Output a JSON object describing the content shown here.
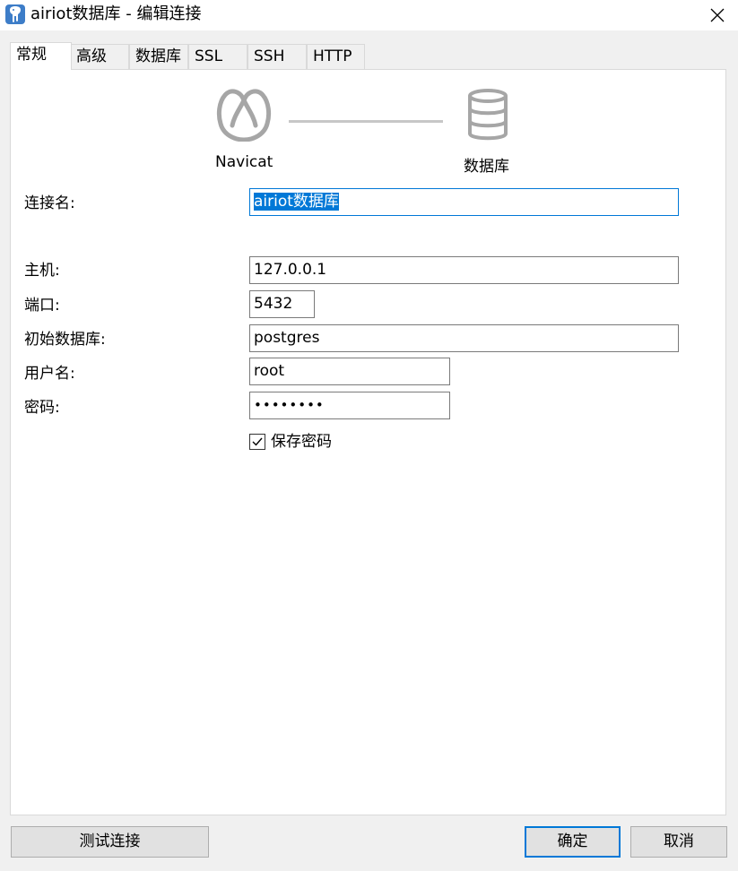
{
  "window": {
    "title": "airiot数据库 - 编辑连接",
    "app_icon": "postgresql-elephant-icon",
    "close_icon": "close-icon"
  },
  "tabs": [
    {
      "label": "常规",
      "active": true
    },
    {
      "label": "高级"
    },
    {
      "label": "数据库"
    },
    {
      "label": "SSL"
    },
    {
      "label": "SSH"
    },
    {
      "label": "HTTP"
    }
  ],
  "diagram": {
    "left_icon": "navicat-logo-icon",
    "left_caption": "Navicat",
    "right_icon": "database-icon",
    "right_caption": "数据库"
  },
  "form": {
    "connection_name": {
      "label": "连接名:",
      "value": "airiot数据库"
    },
    "host": {
      "label": "主机:",
      "value": "127.0.0.1"
    },
    "port": {
      "label": "端口:",
      "value": "5432"
    },
    "initial_database": {
      "label": "初始数据库:",
      "value": "postgres"
    },
    "username": {
      "label": "用户名:",
      "value": "root"
    },
    "password": {
      "label": "密码:",
      "value": "••••••••"
    },
    "save_password": {
      "label": "保存密码",
      "checked": true
    }
  },
  "buttons": {
    "test": "测试连接",
    "ok": "确定",
    "cancel": "取消"
  },
  "colors": {
    "accent": "#0078d7",
    "icon_gray": "#a6a6a6",
    "window_bg": "#f0f0f0"
  }
}
